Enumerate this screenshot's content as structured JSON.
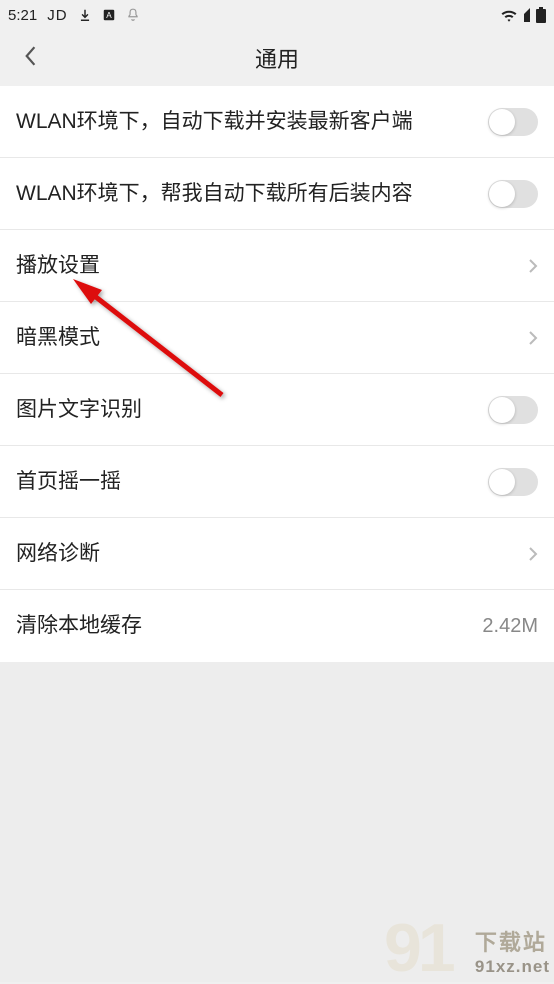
{
  "status": {
    "time": "5:21",
    "jd": "JD"
  },
  "nav": {
    "title": "通用"
  },
  "rows": {
    "wlan_download_client": "WLAN环境下，自动下载并安装最新客户端",
    "wlan_download_content": "WLAN环境下，帮我自动下载所有后装内容",
    "playback_settings": "播放设置",
    "dark_mode": "暗黑模式",
    "image_text_recognition": "图片文字识别",
    "homepage_shake": "首页摇一摇",
    "network_diagnosis": "网络诊断",
    "clear_cache": "清除本地缓存",
    "cache_value": "2.42M"
  },
  "watermark": {
    "line1": "下载站",
    "line2": "91xz.net"
  }
}
